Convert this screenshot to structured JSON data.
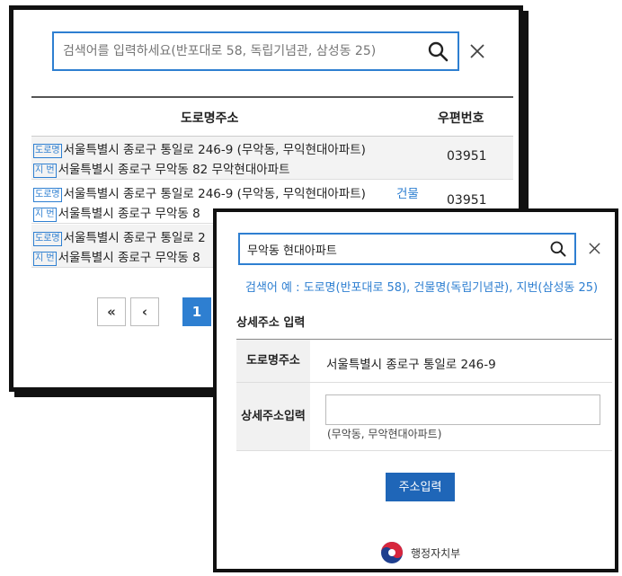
{
  "search_popup": {
    "search_placeholder": "검색어를 입력하세요(반포대로 58, 독립기념관, 삼성동 25)",
    "headers": {
      "address": "도로명주소",
      "zip": "우편번호"
    },
    "tags": {
      "road": "도로명",
      "lot": "지 번"
    },
    "results": [
      {
        "road": "서울특별시 종로구 통일로 246-9 (무악동, 무익현대아파트)",
        "lot": "서울특별시 종로구 무악동 82 무악현대아파트",
        "zip": "03951"
      },
      {
        "road": "서울특별시 종로구 통일로 246-9 (무악동, 무익현대아파트)",
        "lot": "서울특별시 종로구 무악동 8",
        "zip": "03951",
        "building": "건물"
      },
      {
        "road": "서울특별시 종로구 통일로 2",
        "lot": "서울특별시 종로구 무악동 8",
        "zip": ""
      }
    ],
    "pagination": {
      "first": "«",
      "prev": "‹",
      "current": "1"
    }
  },
  "detail_popup": {
    "search_value": "무악동 현대아파트",
    "example": "검색어 예 : 도로명(반포대로 58), 건물명(독립기념관), 지번(삼성동 25)",
    "section_title": "상세주소 입력",
    "road_label": "도로명주소",
    "road_value": "서울특별시 종로구 통일로 246-9",
    "detail_label": "상세주소입력",
    "detail_value": "",
    "extra_address": "(무악동, 무악현대아파트)",
    "submit_label": "주소입력",
    "org": "행정자치부"
  },
  "icons": {
    "search": "search-icon",
    "close": "close-icon",
    "logo": "taegeuk-logo-icon"
  },
  "colors": {
    "accent": "#2e7fd1",
    "button": "#1f66b8",
    "border": "#111111"
  }
}
